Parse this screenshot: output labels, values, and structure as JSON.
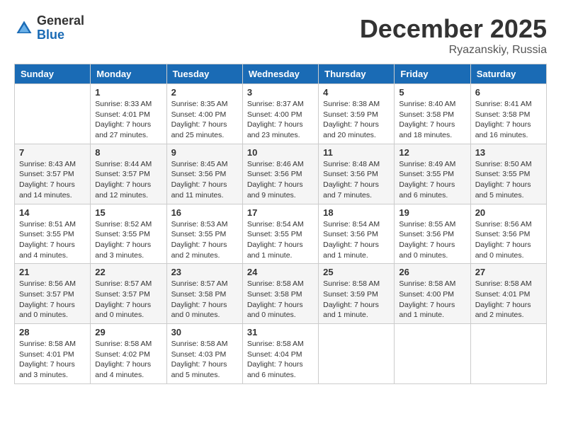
{
  "logo": {
    "general": "General",
    "blue": "Blue"
  },
  "title": "December 2025",
  "location": "Ryazanskiy, Russia",
  "days_header": [
    "Sunday",
    "Monday",
    "Tuesday",
    "Wednesday",
    "Thursday",
    "Friday",
    "Saturday"
  ],
  "weeks": [
    [
      {
        "day": "",
        "info": ""
      },
      {
        "day": "1",
        "info": "Sunrise: 8:33 AM\nSunset: 4:01 PM\nDaylight: 7 hours\nand 27 minutes."
      },
      {
        "day": "2",
        "info": "Sunrise: 8:35 AM\nSunset: 4:00 PM\nDaylight: 7 hours\nand 25 minutes."
      },
      {
        "day": "3",
        "info": "Sunrise: 8:37 AM\nSunset: 4:00 PM\nDaylight: 7 hours\nand 23 minutes."
      },
      {
        "day": "4",
        "info": "Sunrise: 8:38 AM\nSunset: 3:59 PM\nDaylight: 7 hours\nand 20 minutes."
      },
      {
        "day": "5",
        "info": "Sunrise: 8:40 AM\nSunset: 3:58 PM\nDaylight: 7 hours\nand 18 minutes."
      },
      {
        "day": "6",
        "info": "Sunrise: 8:41 AM\nSunset: 3:58 PM\nDaylight: 7 hours\nand 16 minutes."
      }
    ],
    [
      {
        "day": "7",
        "info": "Sunrise: 8:43 AM\nSunset: 3:57 PM\nDaylight: 7 hours\nand 14 minutes."
      },
      {
        "day": "8",
        "info": "Sunrise: 8:44 AM\nSunset: 3:57 PM\nDaylight: 7 hours\nand 12 minutes."
      },
      {
        "day": "9",
        "info": "Sunrise: 8:45 AM\nSunset: 3:56 PM\nDaylight: 7 hours\nand 11 minutes."
      },
      {
        "day": "10",
        "info": "Sunrise: 8:46 AM\nSunset: 3:56 PM\nDaylight: 7 hours\nand 9 minutes."
      },
      {
        "day": "11",
        "info": "Sunrise: 8:48 AM\nSunset: 3:56 PM\nDaylight: 7 hours\nand 7 minutes."
      },
      {
        "day": "12",
        "info": "Sunrise: 8:49 AM\nSunset: 3:55 PM\nDaylight: 7 hours\nand 6 minutes."
      },
      {
        "day": "13",
        "info": "Sunrise: 8:50 AM\nSunset: 3:55 PM\nDaylight: 7 hours\nand 5 minutes."
      }
    ],
    [
      {
        "day": "14",
        "info": "Sunrise: 8:51 AM\nSunset: 3:55 PM\nDaylight: 7 hours\nand 4 minutes."
      },
      {
        "day": "15",
        "info": "Sunrise: 8:52 AM\nSunset: 3:55 PM\nDaylight: 7 hours\nand 3 minutes."
      },
      {
        "day": "16",
        "info": "Sunrise: 8:53 AM\nSunset: 3:55 PM\nDaylight: 7 hours\nand 2 minutes."
      },
      {
        "day": "17",
        "info": "Sunrise: 8:54 AM\nSunset: 3:55 PM\nDaylight: 7 hours\nand 1 minute."
      },
      {
        "day": "18",
        "info": "Sunrise: 8:54 AM\nSunset: 3:56 PM\nDaylight: 7 hours\nand 1 minute."
      },
      {
        "day": "19",
        "info": "Sunrise: 8:55 AM\nSunset: 3:56 PM\nDaylight: 7 hours\nand 0 minutes."
      },
      {
        "day": "20",
        "info": "Sunrise: 8:56 AM\nSunset: 3:56 PM\nDaylight: 7 hours\nand 0 minutes."
      }
    ],
    [
      {
        "day": "21",
        "info": "Sunrise: 8:56 AM\nSunset: 3:57 PM\nDaylight: 7 hours\nand 0 minutes."
      },
      {
        "day": "22",
        "info": "Sunrise: 8:57 AM\nSunset: 3:57 PM\nDaylight: 7 hours\nand 0 minutes."
      },
      {
        "day": "23",
        "info": "Sunrise: 8:57 AM\nSunset: 3:58 PM\nDaylight: 7 hours\nand 0 minutes."
      },
      {
        "day": "24",
        "info": "Sunrise: 8:58 AM\nSunset: 3:58 PM\nDaylight: 7 hours\nand 0 minutes."
      },
      {
        "day": "25",
        "info": "Sunrise: 8:58 AM\nSunset: 3:59 PM\nDaylight: 7 hours\nand 1 minute."
      },
      {
        "day": "26",
        "info": "Sunrise: 8:58 AM\nSunset: 4:00 PM\nDaylight: 7 hours\nand 1 minute."
      },
      {
        "day": "27",
        "info": "Sunrise: 8:58 AM\nSunset: 4:01 PM\nDaylight: 7 hours\nand 2 minutes."
      }
    ],
    [
      {
        "day": "28",
        "info": "Sunrise: 8:58 AM\nSunset: 4:01 PM\nDaylight: 7 hours\nand 3 minutes."
      },
      {
        "day": "29",
        "info": "Sunrise: 8:58 AM\nSunset: 4:02 PM\nDaylight: 7 hours\nand 4 minutes."
      },
      {
        "day": "30",
        "info": "Sunrise: 8:58 AM\nSunset: 4:03 PM\nDaylight: 7 hours\nand 5 minutes."
      },
      {
        "day": "31",
        "info": "Sunrise: 8:58 AM\nSunset: 4:04 PM\nDaylight: 7 hours\nand 6 minutes."
      },
      {
        "day": "",
        "info": ""
      },
      {
        "day": "",
        "info": ""
      },
      {
        "day": "",
        "info": ""
      }
    ]
  ]
}
